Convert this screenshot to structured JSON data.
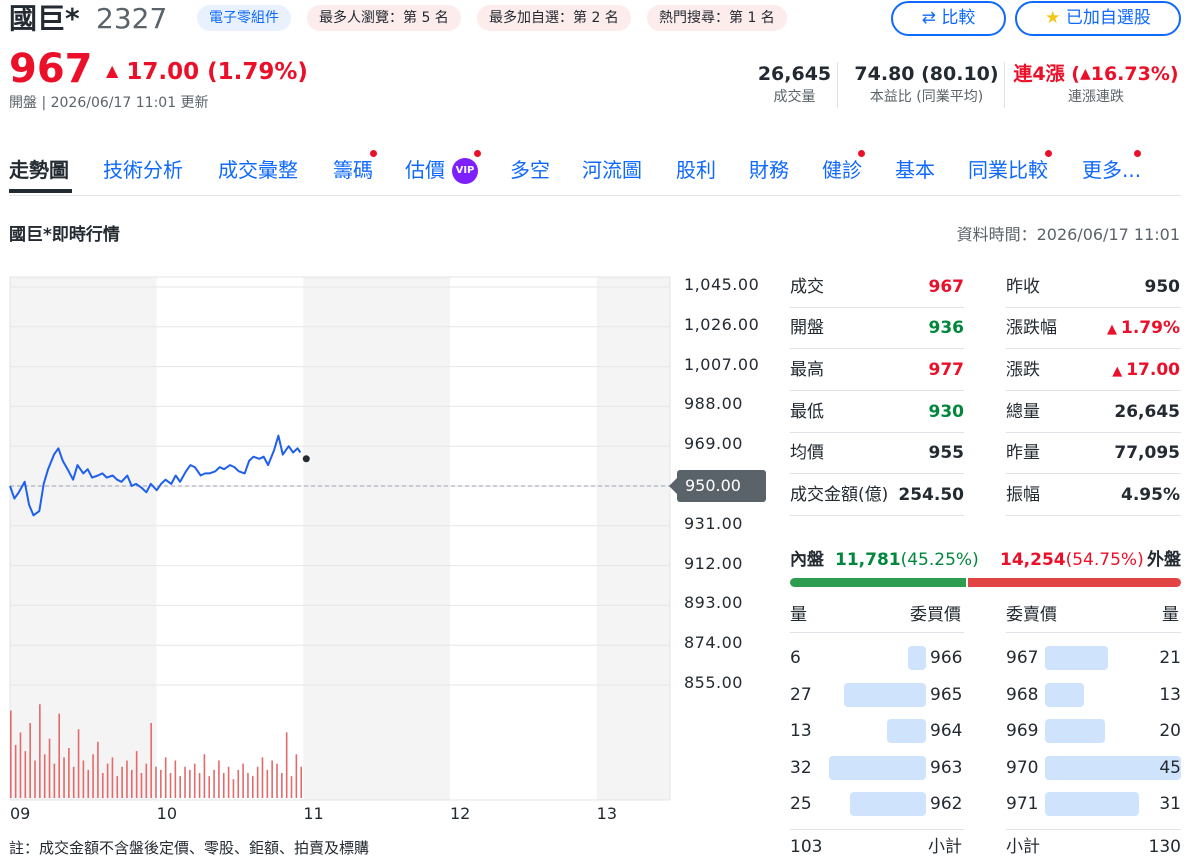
{
  "header": {
    "name": "國巨*",
    "code": "2327",
    "chips": {
      "category": "電子零組件",
      "rank_view": "最多人瀏覽：第 5 名",
      "rank_watch": "最多加自選：第 2 名",
      "rank_search": "熱門搜尋：第 1 名"
    },
    "compare_label": "比較",
    "watchlist_label": "已加自選股",
    "price": "967",
    "change": "17.00",
    "change_pct": "(1.79%)",
    "status": "開盤 | 2026/06/17 11:01 更新",
    "stats": {
      "volume_value": "26,645",
      "volume_label": "成交量",
      "pe_value": "74.80 (80.10)",
      "pe_label": "本益比 (同業平均)",
      "streak_value": "連4漲 (",
      "streak_pct": "16.73%)",
      "streak_label": "連漲連跌"
    }
  },
  "tabs": [
    "走勢圖",
    "技術分析",
    "成交彙整",
    "籌碼",
    "估價",
    "多空",
    "河流圖",
    "股利",
    "財務",
    "健診",
    "基本",
    "同業比較",
    "更多..."
  ],
  "vip_label": "VIP",
  "section": {
    "title": "國巨*即時行情",
    "data_time": "資料時間：2026/06/17 11:01"
  },
  "chart_data": {
    "type": "line",
    "title": "",
    "x_ticks": [
      "09",
      "10",
      "11",
      "12",
      "13"
    ],
    "y_ticks": [
      "1,045.00",
      "1,026.00",
      "1,007.00",
      "988.00",
      "969.00",
      "950.00",
      "931.00",
      "912.00",
      "893.00",
      "874.00",
      "855.00"
    ],
    "ylim": [
      855,
      1045
    ],
    "reference_price": 950,
    "reference_label": "950.00",
    "x_range_hours": [
      9,
      13.5
    ],
    "series": [
      {
        "x": [
          9.0,
          9.03,
          9.06,
          9.1,
          9.13,
          9.16,
          9.2,
          9.23,
          9.26,
          9.3,
          9.33,
          9.36,
          9.4,
          9.43,
          9.46,
          9.5,
          9.53,
          9.56,
          9.6,
          9.63,
          9.66,
          9.7,
          9.73,
          9.76,
          9.8,
          9.83,
          9.86,
          9.9,
          9.93,
          9.96,
          10.0,
          10.03,
          10.06,
          10.1,
          10.13,
          10.16,
          10.2,
          10.23,
          10.26,
          10.3,
          10.33,
          10.36,
          10.4,
          10.43,
          10.46,
          10.5,
          10.53,
          10.56,
          10.6,
          10.63,
          10.66,
          10.7,
          10.73,
          10.76,
          10.8,
          10.83,
          10.86,
          10.9,
          10.93,
          10.96,
          10.98
        ],
        "values": [
          950,
          944,
          947,
          952,
          941,
          936,
          938,
          951,
          958,
          965,
          968,
          962,
          957,
          953,
          960,
          956,
          958,
          954,
          955,
          956,
          954,
          955,
          953,
          952,
          955,
          950,
          951,
          949,
          947,
          951,
          948,
          951,
          953,
          951,
          955,
          952,
          957,
          960,
          959,
          955,
          956,
          956,
          957,
          959,
          958,
          960,
          959,
          957,
          956,
          962,
          964,
          963,
          964,
          960,
          967,
          974,
          965,
          969,
          966,
          968,
          966
        ]
      }
    ],
    "volume_values": [
      28,
      17,
      21,
      15,
      24,
      12,
      30,
      14,
      19,
      11,
      27,
      13,
      16,
      10,
      22,
      12,
      9,
      14,
      18,
      8,
      11,
      13,
      7,
      10,
      12,
      9,
      15,
      8,
      11,
      24,
      10,
      9,
      13,
      8,
      12,
      7,
      10,
      9,
      11,
      8,
      14,
      7,
      9,
      12,
      8,
      10,
      6,
      9,
      11,
      8,
      7,
      10,
      13,
      9,
      12,
      11,
      8,
      21,
      7,
      14,
      10
    ]
  },
  "quote": {
    "rows": [
      {
        "l1": "成交",
        "v1": "967",
        "c1": "red",
        "l2": "昨收",
        "v2": "950",
        "c2": ""
      },
      {
        "l1": "開盤",
        "v1": "936",
        "c1": "grn",
        "l2": "漲跌幅",
        "v2": "1.79%",
        "c2": "red",
        "arrow2": true
      },
      {
        "l1": "最高",
        "v1": "977",
        "c1": "red",
        "l2": "漲跌",
        "v2": "17.00",
        "c2": "red",
        "arrow2": true
      },
      {
        "l1": "最低",
        "v1": "930",
        "c1": "grn",
        "l2": "總量",
        "v2": "26,645",
        "c2": ""
      },
      {
        "l1": "均價",
        "v1": "955",
        "c1": "",
        "l2": "昨量",
        "v2": "77,095",
        "c2": ""
      },
      {
        "l1": "成交金額(億)",
        "v1": "254.50",
        "c1": "",
        "l2": "振幅",
        "v2": "4.95%",
        "c2": ""
      }
    ],
    "inner_label": "內盤",
    "inner_value": "11,781",
    "inner_pct": "(45.25%)",
    "outer_value": "14,254",
    "outer_pct": "(54.75%)",
    "outer_label": "外盤",
    "inner_share": 0.4525
  },
  "orderbook": {
    "head_qty": "量",
    "head_bid": "委買價",
    "head_ask": "委賣價",
    "head_qty2": "量",
    "bids": [
      {
        "qty": "6",
        "price": "966",
        "q": 6
      },
      {
        "qty": "27",
        "price": "965",
        "q": 27
      },
      {
        "qty": "13",
        "price": "964",
        "q": 13
      },
      {
        "qty": "32",
        "price": "963",
        "q": 32
      },
      {
        "qty": "25",
        "price": "962",
        "q": 25
      }
    ],
    "asks": [
      {
        "price": "967",
        "qty": "21",
        "q": 21
      },
      {
        "price": "968",
        "qty": "13",
        "q": 13
      },
      {
        "price": "969",
        "qty": "20",
        "q": 20
      },
      {
        "price": "970",
        "qty": "45",
        "q": 45
      },
      {
        "price": "971",
        "qty": "31",
        "q": 31
      }
    ],
    "bid_total": "103",
    "subtotal_label": "小計",
    "ask_total": "130"
  },
  "footnote": "註：成交金額不含盤後定價、零股、鉅額、拍賣及標購",
  "colors": {
    "up": "#eb0f29",
    "down": "#00873c",
    "line": "#1f5ff0",
    "accent": "#0f69ff"
  }
}
